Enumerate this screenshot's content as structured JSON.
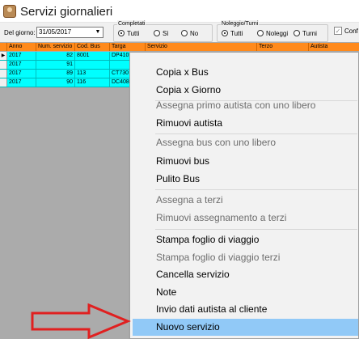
{
  "window": {
    "title": "Servizi giornalieri"
  },
  "filters": {
    "date_label": "Del giorno:",
    "date_value": "31/05/2017",
    "completati": {
      "label": "Completati",
      "options": [
        "Tutti",
        "Sì",
        "No"
      ],
      "selected": "Tutti"
    },
    "noleggio": {
      "label": "Noleggio/Turni",
      "options": [
        "Tutti",
        "Noleggi",
        "Turni"
      ],
      "selected": "Tutti"
    },
    "checkbox_label": "Conf",
    "checkbox_checked": true
  },
  "grid": {
    "columns": [
      "Anno",
      "Num. servizio",
      "Cod. Bus",
      "Targa",
      "Servizio",
      "Terzo",
      "Autista"
    ],
    "rows": [
      {
        "anno": "2017",
        "num": "82",
        "cod": "8001",
        "targa": "DP410"
      },
      {
        "anno": "2017",
        "num": "91",
        "cod": "",
        "targa": ""
      },
      {
        "anno": "2017",
        "num": "89",
        "cod": "113",
        "targa": "CT730"
      },
      {
        "anno": "2017",
        "num": "90",
        "cod": "116",
        "targa": "DC408"
      }
    ],
    "colors": {
      "header": "#ff8a1c",
      "row": "#00ffff"
    }
  },
  "context_menu": {
    "items": [
      {
        "label": "Copia x Bus",
        "enabled": true
      },
      {
        "label": "Copia x Giorno",
        "enabled": true
      },
      {
        "label": "Assegna primo autista con uno libero",
        "enabled": false
      },
      {
        "label": "Rimuovi autista",
        "enabled": true
      },
      {
        "label": "Assegna bus con uno libero",
        "enabled": false
      },
      {
        "label": "Rimuovi bus",
        "enabled": true
      },
      {
        "label": "Pulito Bus",
        "enabled": true
      },
      {
        "label": "Assegna a terzi",
        "enabled": false
      },
      {
        "label": "Rimuovi assegnamento a terzi",
        "enabled": false
      },
      {
        "label": "Stampa foglio di viaggio",
        "enabled": true
      },
      {
        "label": "Stampa foglio di viaggio terzi",
        "enabled": false
      },
      {
        "label": "Cancella servizio",
        "enabled": true
      },
      {
        "label": "Note",
        "enabled": true
      },
      {
        "label": "Invio dati autista al cliente",
        "enabled": true
      },
      {
        "label": "Nuovo servizio",
        "enabled": true,
        "highlighted": true
      }
    ],
    "highlight_color": "#91c9f7"
  },
  "annotation": {
    "arrow_color": "#e02020",
    "points_to": "Nuovo servizio"
  }
}
